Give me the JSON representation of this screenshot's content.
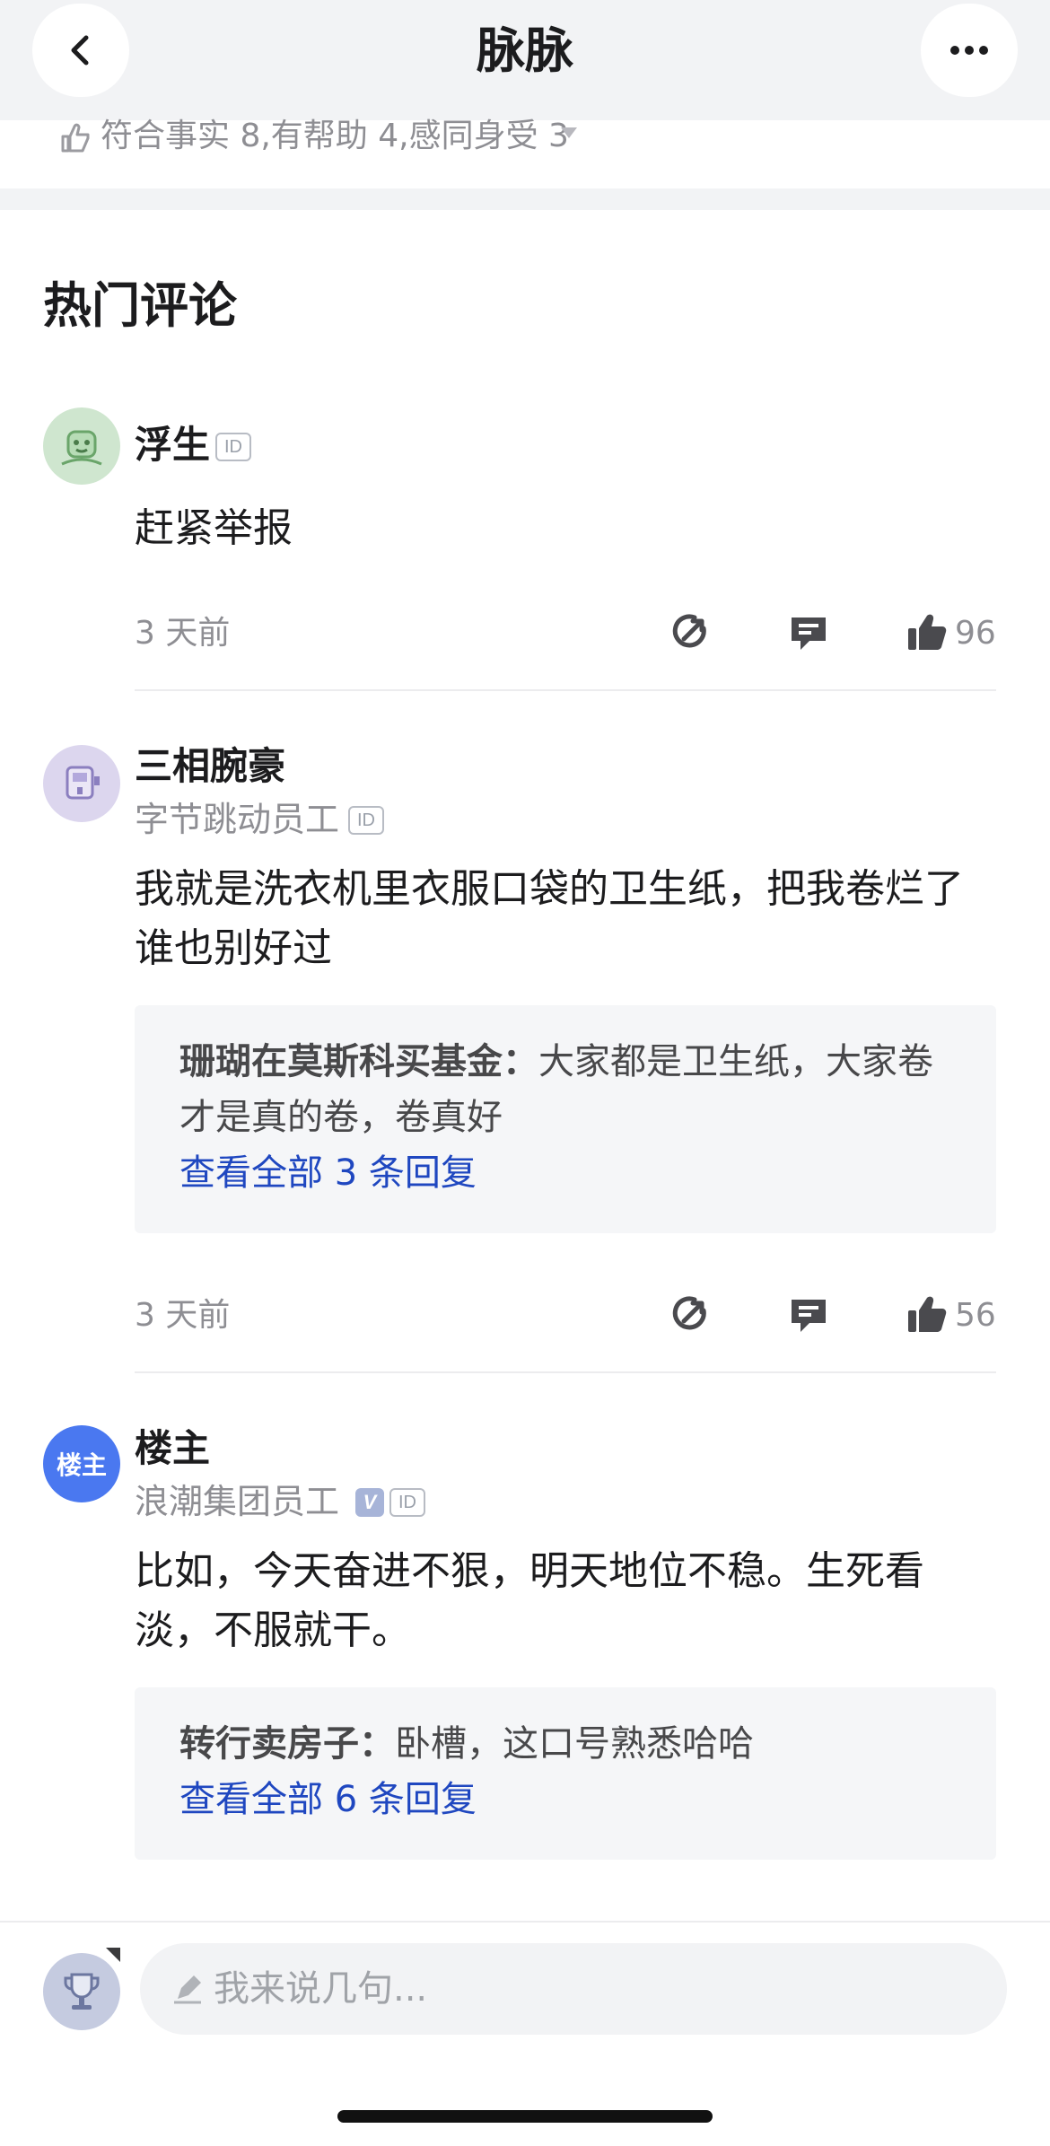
{
  "header": {
    "title": "脉脉",
    "back_icon": "chevron-left-icon",
    "more_icon": "more-dots-icon"
  },
  "summary": {
    "text": "符合事实 8,有帮助 4,感同身受 3"
  },
  "section": {
    "title": "热门评论"
  },
  "comments": [
    {
      "name": "浮生",
      "id_badge": "ID",
      "text": "赶紧举报",
      "time": "3 天前",
      "likes": "96"
    },
    {
      "name": "三相腕豪",
      "subtitle": "字节跳动员工",
      "id_badge": "ID",
      "text": "我就是洗衣机里衣服口袋的卫生纸，把我卷烂了谁也别好过",
      "reply": {
        "author": "珊瑚在莫斯科买基金：",
        "content": "大家都是卫生纸，大家卷才是真的卷，卷真好",
        "more": "查看全部 3 条回复"
      },
      "time": "3 天前",
      "likes": "56"
    },
    {
      "name": "楼主",
      "avatar_text": "楼主",
      "subtitle": "浪潮集团员工",
      "verified_badge": "V",
      "id_badge": "ID",
      "text": "比如，今天奋进不狠，明天地位不稳。生死看淡，不服就干。",
      "reply": {
        "author": "转行卖房子：",
        "content": "卧槽，这口号熟悉哈哈",
        "more": "查看全部 6 条回复"
      }
    }
  ],
  "input": {
    "placeholder": "我来说几句..."
  },
  "colors": {
    "link": "#1f47c0",
    "header_bg": "#f2f3f5",
    "op_avatar": "#4a78f0"
  }
}
